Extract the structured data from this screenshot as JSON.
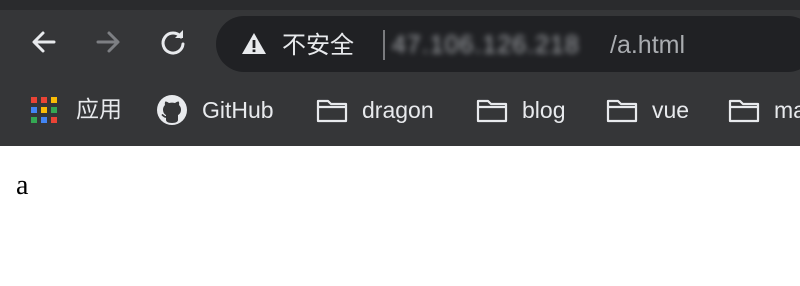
{
  "browser": {
    "nav": {
      "back_icon": "arrow-left-icon",
      "forward_icon": "arrow-right-icon",
      "reload_icon": "reload-icon"
    },
    "address_bar": {
      "security_icon": "warning-triangle-icon",
      "security_status": "不安全",
      "host_obscured": "47.106.126.218",
      "path": "/a.html"
    },
    "bookmarks": [
      {
        "label": "应用",
        "icon": "apps-grid-icon"
      },
      {
        "label": "GitHub",
        "icon": "github-icon"
      },
      {
        "label": "dragon",
        "icon": "folder-icon"
      },
      {
        "label": "blog",
        "icon": "folder-icon"
      },
      {
        "label": "vue",
        "icon": "folder-icon"
      },
      {
        "label": "ma",
        "icon": "folder-icon"
      }
    ]
  },
  "page": {
    "body_text": "a"
  },
  "colors": {
    "toolbar_bg": "#353638",
    "omnibox_bg": "#202124",
    "text_light": "#e8eaed",
    "page_bg": "#ffffff"
  }
}
